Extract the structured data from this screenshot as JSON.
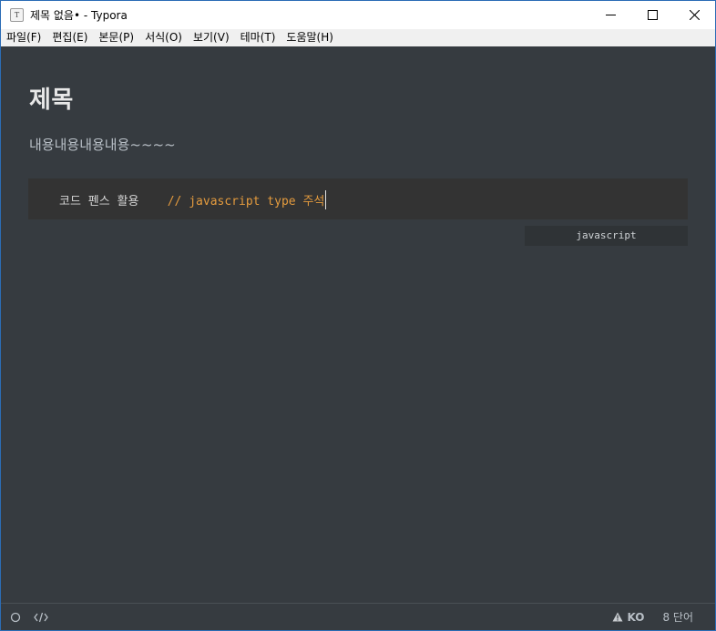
{
  "window": {
    "title": "제목 없음• - Typora",
    "app_icon_letter": "T"
  },
  "menubar": {
    "items": [
      {
        "label": "파일(F)"
      },
      {
        "label": "편집(E)"
      },
      {
        "label": "본문(P)"
      },
      {
        "label": "서식(O)"
      },
      {
        "label": "보기(V)"
      },
      {
        "label": "테마(T)"
      },
      {
        "label": "도움말(H)"
      }
    ]
  },
  "document": {
    "heading": "제목",
    "paragraph": "내용내용내용내용~~~~",
    "code_block": {
      "code_text": "코드 펜스 활용",
      "comment": "// javascript type 주석",
      "language": "javascript"
    }
  },
  "statusbar": {
    "language": "KO",
    "word_count": "8 단어"
  },
  "colors": {
    "editor_bg": "#363b40",
    "code_bg": "#333333",
    "comment": "#e49b3e",
    "text": "#b8bfc6",
    "heading": "#e8e8e8"
  },
  "icons": {
    "window_minimize": "minimize-icon",
    "window_maximize": "maximize-icon",
    "window_close": "close-icon",
    "status_outline": "outline-circle-icon",
    "status_source": "source-code-icon",
    "status_warning": "warning-icon"
  }
}
